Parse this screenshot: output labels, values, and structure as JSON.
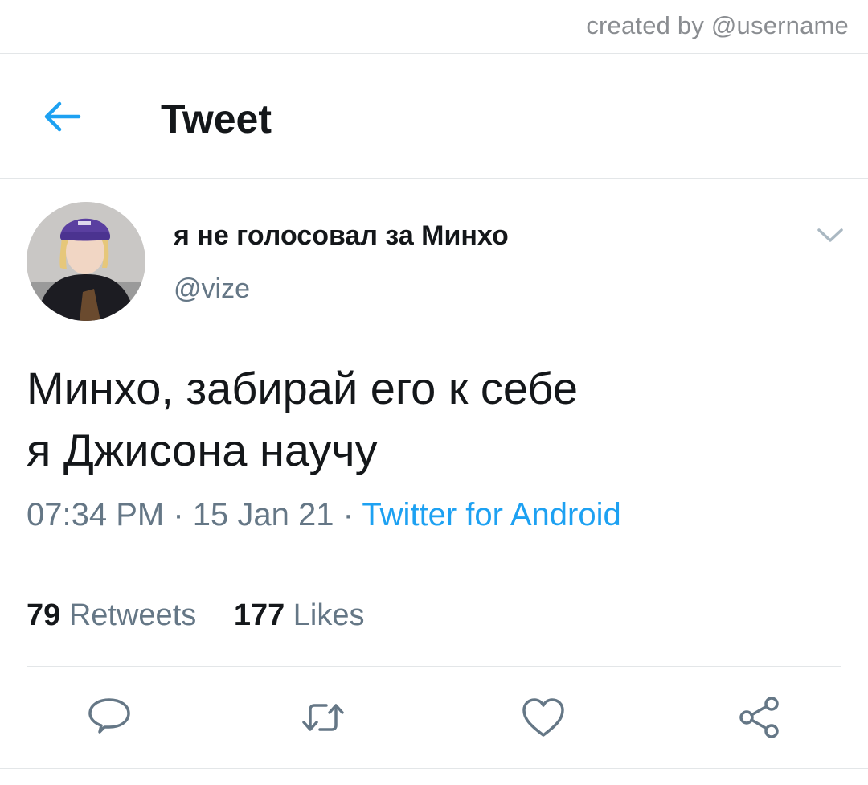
{
  "credit": {
    "text": "created by @username"
  },
  "header": {
    "title": "Tweet",
    "back_icon": "arrow-left-icon"
  },
  "author": {
    "display_name": "я не голосовал за Минхо",
    "handle": "@vize"
  },
  "tweet": {
    "lines": [
      "Минхо, забирай его к себе",
      "я Джисона научу"
    ],
    "time": "07:34 PM",
    "date": "15 Jan 21",
    "separator": "·",
    "source": "Twitter for Android"
  },
  "stats": {
    "retweets_count": "79",
    "retweets_label": "Retweets",
    "likes_count": "177",
    "likes_label": "Likes"
  },
  "actions": [
    "reply-icon",
    "retweet-icon",
    "heart-icon",
    "share-icon"
  ],
  "colors": {
    "accent": "#1da1f2",
    "text": "#14171a",
    "secondary": "#657786",
    "divider": "#e3e6e8"
  }
}
